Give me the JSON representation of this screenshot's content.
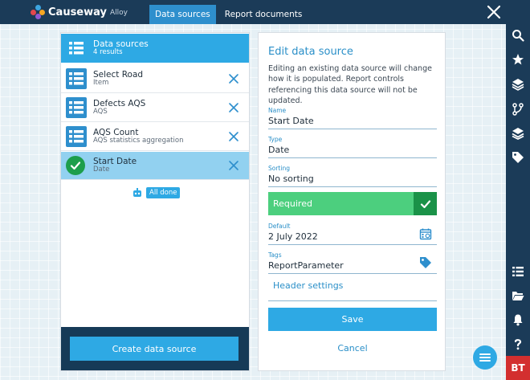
{
  "app": {
    "brand": "Causeway",
    "brand_sub": "Alloy",
    "user_initials": "BT"
  },
  "tabs": [
    {
      "label": "Data sources",
      "active": true
    },
    {
      "label": "Report documents",
      "active": false
    }
  ],
  "rail_icons": [
    "search-icon",
    "star-icon",
    "layers-icon",
    "workflow-icon",
    "layers-stack-icon",
    "tag-icon",
    "list-icon",
    "folder-open-icon",
    "bell-icon",
    "help-icon"
  ],
  "left": {
    "header": {
      "title": "Data sources",
      "subtitle": "4 results"
    },
    "items": [
      {
        "title": "Select Road",
        "subtitle": "Item",
        "selected": false
      },
      {
        "title": "Defects AQS",
        "subtitle": "AQS",
        "selected": false
      },
      {
        "title": "AQS Count",
        "subtitle": "AQS statistics aggregation",
        "selected": false
      },
      {
        "title": "Start Date",
        "subtitle": "Date",
        "selected": true
      }
    ],
    "all_done": "All done",
    "create_label": "Create data source"
  },
  "edit": {
    "title": "Edit data source",
    "description": "Editing an existing data source will change how it is populated. Report controls referencing this data source will not be updated.",
    "fields": {
      "name": {
        "label": "Name",
        "value": "Start Date"
      },
      "type": {
        "label": "Type",
        "value": "Date"
      },
      "sorting": {
        "label": "Sorting",
        "value": "No sorting"
      },
      "default": {
        "label": "Default",
        "value": "2 July 2022"
      },
      "tags": {
        "label": "Tags",
        "value": "ReportParameter"
      }
    },
    "required_label": "Required",
    "header_settings_label": "Header settings",
    "save_label": "Save",
    "cancel_label": "Cancel"
  },
  "colors": {
    "topbar": "#1b3b58",
    "accent": "#2ea9e4",
    "required_green": "#4ccf7e",
    "check_green": "#1a9248",
    "selected_row": "#92d1f0",
    "user_badge": "#d32f2f"
  }
}
